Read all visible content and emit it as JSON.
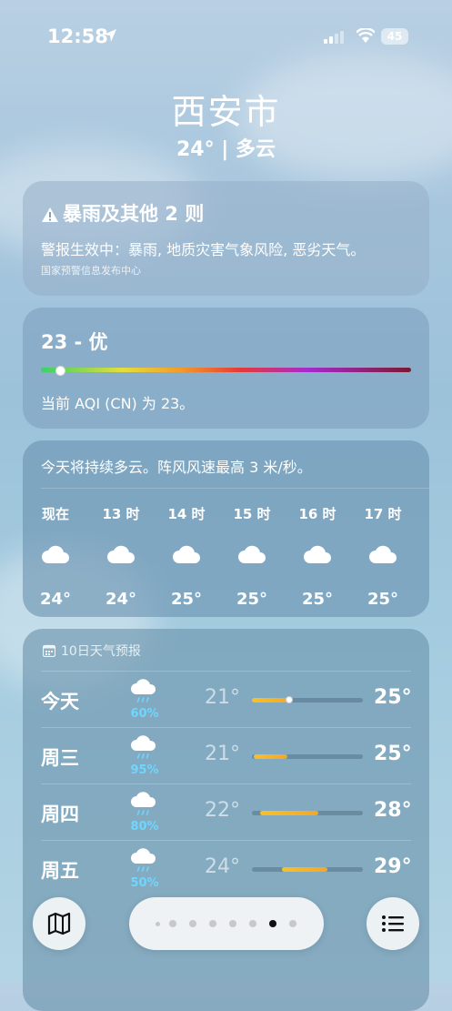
{
  "status": {
    "time": "12:58",
    "battery": "45"
  },
  "location": {
    "city": "西安市",
    "condition": "24° | 多云"
  },
  "alert": {
    "title": "暴雨及其他 2 则",
    "body": "警报生效中：暴雨, 地质灾害气象风险, 恶劣天气。",
    "source": "国家预警信息发布中心"
  },
  "aqi": {
    "value_label": "23 - 优",
    "value": 23,
    "description": "当前 AQI (CN) 为 23。"
  },
  "hourly": {
    "summary": "今天将持续多云。阵风风速最高 3 米/秒。",
    "hours": [
      {
        "label": "现在",
        "icon": "cloud-icon",
        "temp": "24°"
      },
      {
        "label": "13 时",
        "icon": "cloud-icon",
        "temp": "24°"
      },
      {
        "label": "14 时",
        "icon": "cloud-icon",
        "temp": "25°"
      },
      {
        "label": "15 时",
        "icon": "cloud-icon",
        "temp": "25°"
      },
      {
        "label": "16 时",
        "icon": "cloud-icon",
        "temp": "25°"
      },
      {
        "label": "17 时",
        "icon": "cloud-icon",
        "temp": "25°"
      }
    ]
  },
  "daily": {
    "header": "10日天气预报",
    "days": [
      {
        "day": "今天",
        "icon": "cloud-rain-icon",
        "precip": "60%",
        "low": "21°",
        "high": "25°",
        "range_start": 0.0,
        "range_end": 0.37,
        "current": 0.3
      },
      {
        "day": "周三",
        "icon": "cloud-rain-icon",
        "precip": "95%",
        "low": "21°",
        "high": "25°",
        "range_start": 0.02,
        "range_end": 0.32
      },
      {
        "day": "周四",
        "icon": "cloud-rain-icon",
        "precip": "80%",
        "low": "22°",
        "high": "28°",
        "range_start": 0.07,
        "range_end": 0.6
      },
      {
        "day": "周五",
        "icon": "cloud-rain-icon",
        "precip": "50%",
        "low": "24°",
        "high": "29°",
        "range_start": 0.27,
        "range_end": 0.68
      }
    ]
  },
  "pager": {
    "pages": 8,
    "active": 6
  },
  "colors": {
    "accent_precip": "#6fd6ff",
    "temp_bar": "#f6c12a"
  }
}
